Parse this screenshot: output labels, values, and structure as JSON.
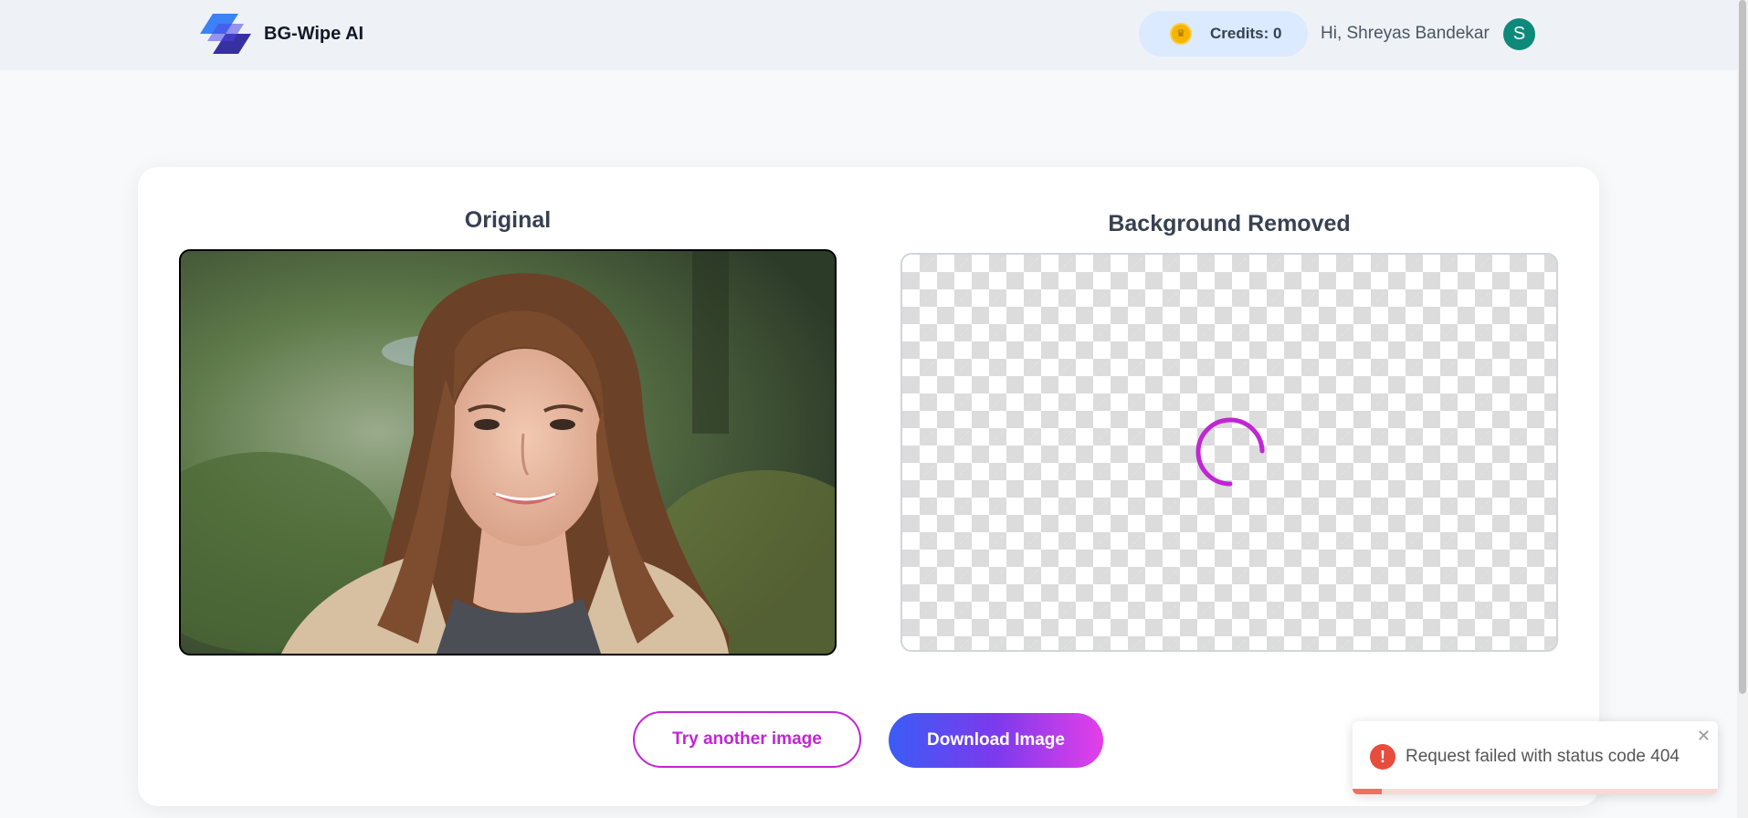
{
  "header": {
    "app_name": "BG-Wipe AI",
    "credits_label": "Credits: 0",
    "greeting": "Hi, Shreyas Bandekar",
    "avatar_initial": "S",
    "icons": {
      "logo": "parallelogram-logo-icon",
      "coin": "crown-coin-icon"
    }
  },
  "panels": {
    "original_title": "Original",
    "removed_title": "Background Removed",
    "original_image_alt": "Portrait photo of a smiling woman with long brown hair",
    "spinner": "loading-spinner-icon"
  },
  "actions": {
    "try_another": "Try another image",
    "download": "Download Image"
  },
  "toast": {
    "message": "Request failed with status code 404",
    "close_glyph": "✕",
    "icon_glyph": "!",
    "progress_fraction": 0.08
  },
  "colors": {
    "accent_magenta": "#c026d3",
    "gradient_start": "#3b5cf6",
    "gradient_end": "#e43fe8",
    "error_red": "#e74c3c",
    "avatar_teal": "#0f8a7a"
  }
}
